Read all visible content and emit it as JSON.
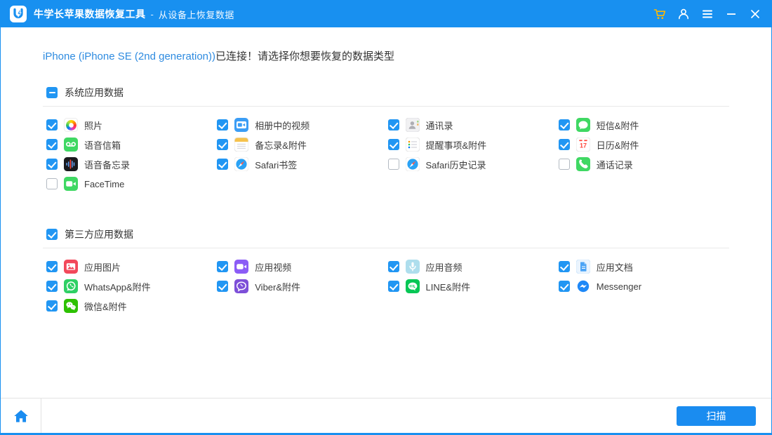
{
  "titlebar": {
    "app_title": "牛学长苹果数据恢复工具",
    "separator": "-",
    "subtitle": "从设备上恢复数据",
    "action_icons": [
      "cart-icon",
      "user-icon",
      "menu-icon",
      "minimize-icon",
      "close-icon"
    ]
  },
  "header": {
    "device": "iPhone (iPhone SE (2nd generation))",
    "message": "已连接！请选择你想要恢复的数据类型"
  },
  "sections": [
    {
      "title": "系统应用数据",
      "state": "indeterminate",
      "items": [
        {
          "label": "照片",
          "checked": true,
          "icon": "photos-icon"
        },
        {
          "label": "相册中的视频",
          "checked": true,
          "icon": "album-video-icon"
        },
        {
          "label": "通讯录",
          "checked": true,
          "icon": "contacts-icon"
        },
        {
          "label": "短信&附件",
          "checked": true,
          "icon": "messages-icon"
        },
        {
          "label": "语音信箱",
          "checked": true,
          "icon": "voicemail-icon"
        },
        {
          "label": "备忘录&附件",
          "checked": true,
          "icon": "notes-icon"
        },
        {
          "label": "提醒事项&附件",
          "checked": true,
          "icon": "reminders-icon"
        },
        {
          "label": "日历&附件",
          "checked": true,
          "icon": "calendar-icon"
        },
        {
          "label": "语音备忘录",
          "checked": true,
          "icon": "voice-memos-icon"
        },
        {
          "label": "Safari书签",
          "checked": true,
          "icon": "safari-icon"
        },
        {
          "label": "Safari历史记录",
          "checked": false,
          "icon": "safari-icon"
        },
        {
          "label": "通话记录",
          "checked": false,
          "icon": "phone-icon"
        },
        {
          "label": "FaceTime",
          "checked": false,
          "icon": "facetime-icon"
        }
      ]
    },
    {
      "title": "第三方应用数据",
      "state": "checked",
      "items": [
        {
          "label": "应用图片",
          "checked": true,
          "icon": "app-photo-icon"
        },
        {
          "label": "应用视频",
          "checked": true,
          "icon": "app-video-icon"
        },
        {
          "label": "应用音频",
          "checked": true,
          "icon": "app-audio-icon"
        },
        {
          "label": "应用文档",
          "checked": true,
          "icon": "app-doc-icon"
        },
        {
          "label": "WhatsApp&附件",
          "checked": true,
          "icon": "whatsapp-icon"
        },
        {
          "label": "Viber&附件",
          "checked": true,
          "icon": "viber-icon"
        },
        {
          "label": "LINE&附件",
          "checked": true,
          "icon": "line-icon"
        },
        {
          "label": "Messenger",
          "checked": true,
          "icon": "messenger-icon"
        },
        {
          "label": "微信&附件",
          "checked": true,
          "icon": "wechat-icon"
        }
      ]
    }
  ],
  "footer": {
    "scan_label": "扫描"
  },
  "colors": {
    "titlebar": "#1890f0",
    "accent": "#1a8cf0",
    "checkbox": "#2196f3",
    "cart": "#ffb800",
    "device_text": "#2e8be0",
    "divider": "#e9e9e9"
  }
}
